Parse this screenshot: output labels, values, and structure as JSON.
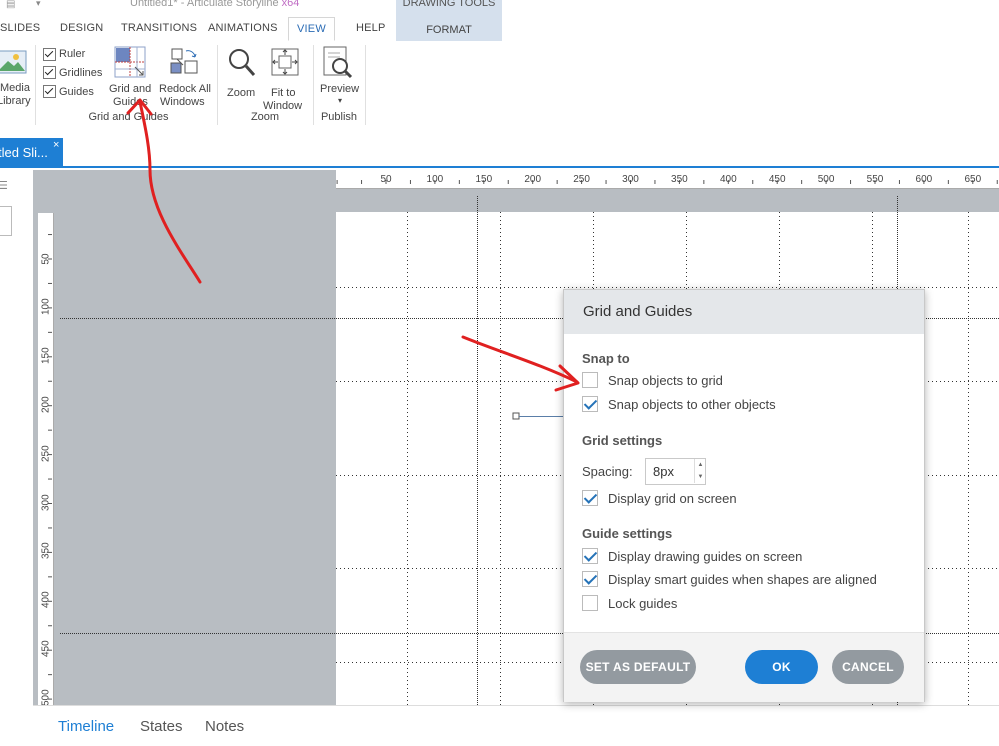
{
  "window": {
    "title": "Untitled1* -  Articulate Storyline",
    "arch": "x64"
  },
  "ribbon_tabs": [
    "SLIDES",
    "DESIGN",
    "TRANSITIONS",
    "ANIMATIONS",
    "VIEW",
    "HELP"
  ],
  "contextual_tab": {
    "header": "DRAWING TOOLS",
    "tab": "FORMAT"
  },
  "ribbon": {
    "media": {
      "line1": "Media",
      "line2": "Library"
    },
    "checks": [
      "Ruler",
      "Gridlines",
      "Guides"
    ],
    "grid_guides": {
      "line1": "Grid and",
      "line2": "Guides"
    },
    "redock": {
      "line1": "Redock All",
      "line2": "Windows"
    },
    "group_grid": "Grid and Guides",
    "zoom": "Zoom",
    "fit": {
      "line1": "Fit to",
      "line2": "Window"
    },
    "group_zoom": "Zoom",
    "preview": "Preview",
    "group_publish": "Publish"
  },
  "doc_tab": {
    "label": "tled Sli...",
    "close": "×"
  },
  "ruler": {
    "h_ticks": [
      "50",
      "100",
      "150",
      "200",
      "250",
      "300",
      "350",
      "400",
      "450",
      "500",
      "550",
      "600",
      "650"
    ],
    "v_ticks": [
      "50",
      "100",
      "150",
      "200",
      "250",
      "300",
      "350",
      "400",
      "450",
      "500"
    ]
  },
  "dialog": {
    "title": "Grid and Guides",
    "snap_section": "Snap to",
    "snap_grid": {
      "label": "Snap objects to grid",
      "checked": false
    },
    "snap_objects": {
      "label": "Snap objects to other objects",
      "checked": true
    },
    "grid_section": "Grid settings",
    "spacing_label": "Spacing:",
    "spacing_value": "8px",
    "display_grid": {
      "label": "Display grid on screen",
      "checked": true
    },
    "guide_section": "Guide settings",
    "drawing_guides": {
      "label": "Display drawing guides on screen",
      "checked": true
    },
    "smart_guides": {
      "label": "Display smart guides when shapes are aligned",
      "checked": true
    },
    "lock_guides": {
      "label": "Lock guides",
      "checked": false
    },
    "btn_default": "SET AS DEFAULT",
    "btn_ok": "OK",
    "btn_cancel": "CANCEL"
  },
  "bottom_tabs": [
    "Timeline",
    "States",
    "Notes"
  ],
  "colors": {
    "accent": "#1e7fd4",
    "annotation": "#e02020",
    "workspace": "#b8bdc2"
  }
}
